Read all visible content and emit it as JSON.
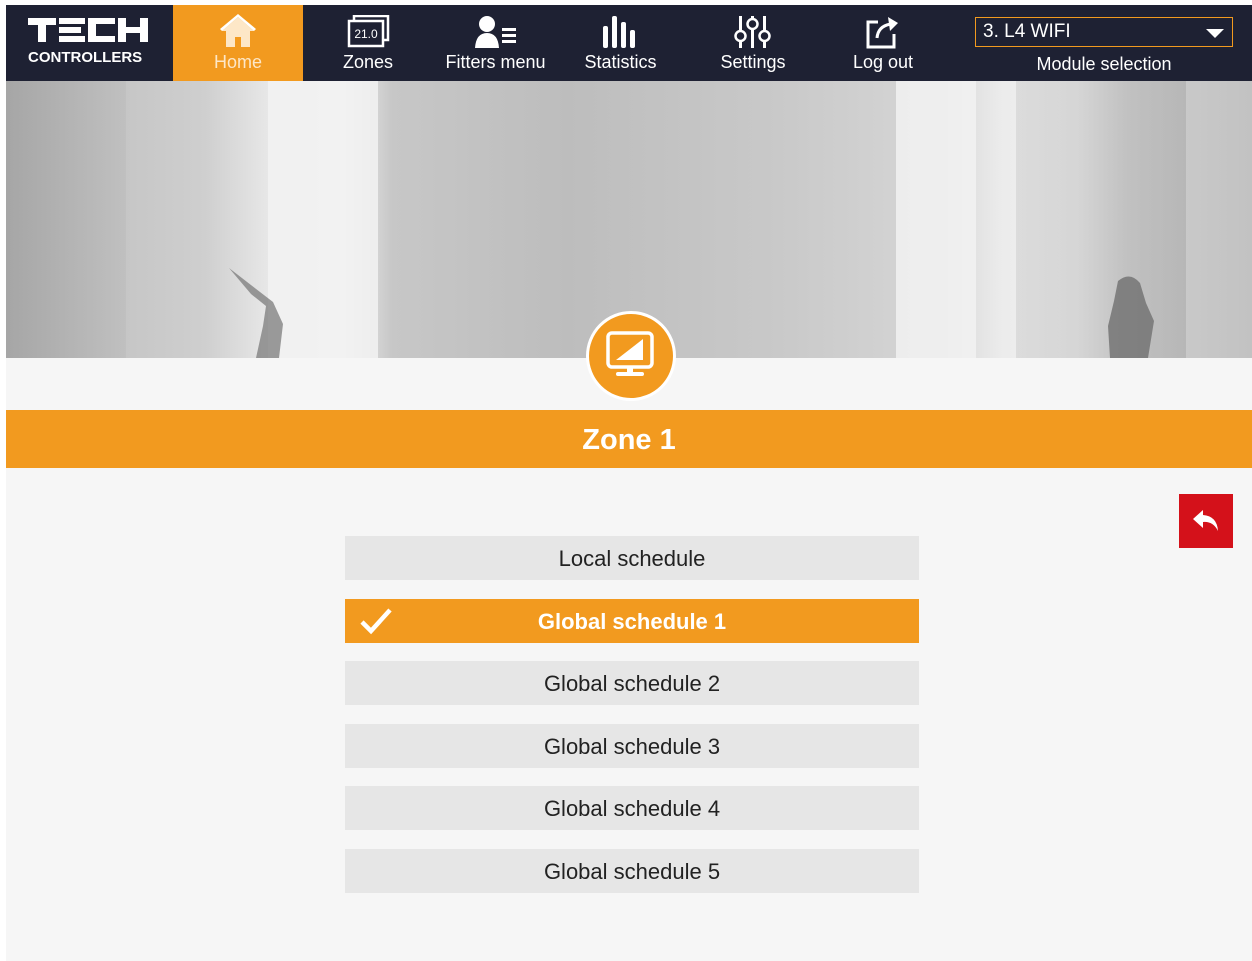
{
  "brand": {
    "logo_text": "TECH",
    "subtitle": "CONTROLLERS"
  },
  "nav": [
    {
      "label": "Home",
      "icon": "home-icon",
      "active": true
    },
    {
      "label": "Zones",
      "icon": "zones-thermostat-icon",
      "icon_text": "21.0",
      "active": false
    },
    {
      "label": "Fitters menu",
      "icon": "fitter-user-icon",
      "active": false
    },
    {
      "label": "Statistics",
      "icon": "statistics-bars-icon",
      "active": false
    },
    {
      "label": "Settings",
      "icon": "settings-sliders-icon",
      "active": false
    },
    {
      "label": "Log out",
      "icon": "logout-icon",
      "active": false
    }
  ],
  "module": {
    "selected": "3. L4 WIFI",
    "label": "Module selection"
  },
  "zone": {
    "title": "Zone 1",
    "icon": "monitor-icon"
  },
  "back_button": {
    "icon": "back-arrow-icon"
  },
  "schedules": [
    {
      "label": "Local schedule",
      "selected": false
    },
    {
      "label": "Global schedule 1",
      "selected": true
    },
    {
      "label": "Global schedule 2",
      "selected": false
    },
    {
      "label": "Global schedule 3",
      "selected": false
    },
    {
      "label": "Global schedule 4",
      "selected": false
    },
    {
      "label": "Global schedule 5",
      "selected": false
    }
  ],
  "colors": {
    "accent": "#f29a1f",
    "navbar": "#1e2133",
    "back_button": "#d4111a",
    "row": "#e6e6e6"
  }
}
